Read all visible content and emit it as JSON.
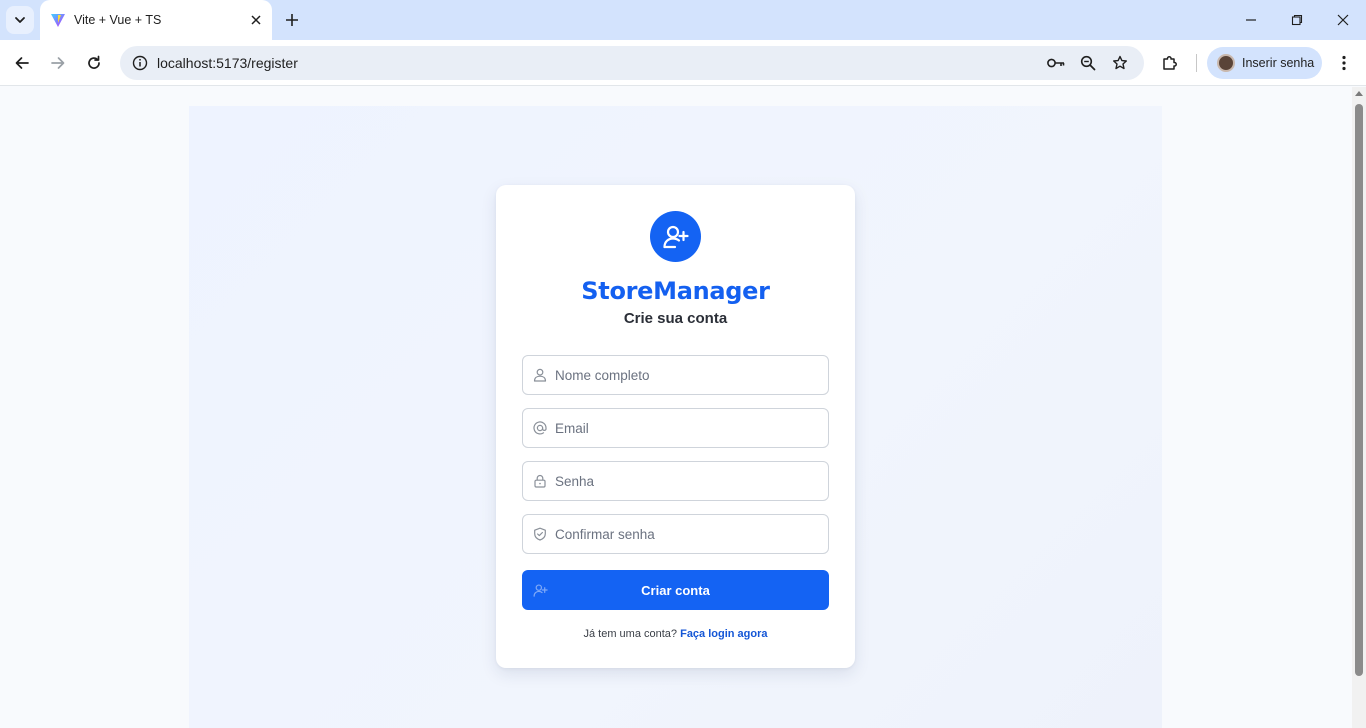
{
  "browser": {
    "tab_title": "Vite + Vue + TS",
    "url": "localhost:5173/register",
    "profile_label": "Inserir senha"
  },
  "app": {
    "brand": "StoreManager",
    "subtitle": "Crie sua conta",
    "fields": {
      "name_placeholder": "Nome completo",
      "email_placeholder": "Email",
      "password_placeholder": "Senha",
      "confirm_placeholder": "Confirmar senha"
    },
    "submit_label": "Criar conta",
    "footer_text": "Já tem uma conta?",
    "footer_link": "Faça login agora"
  },
  "colors": {
    "accent": "#1463f3",
    "link": "#1456d6",
    "tabstrip": "#d3e3fd"
  }
}
